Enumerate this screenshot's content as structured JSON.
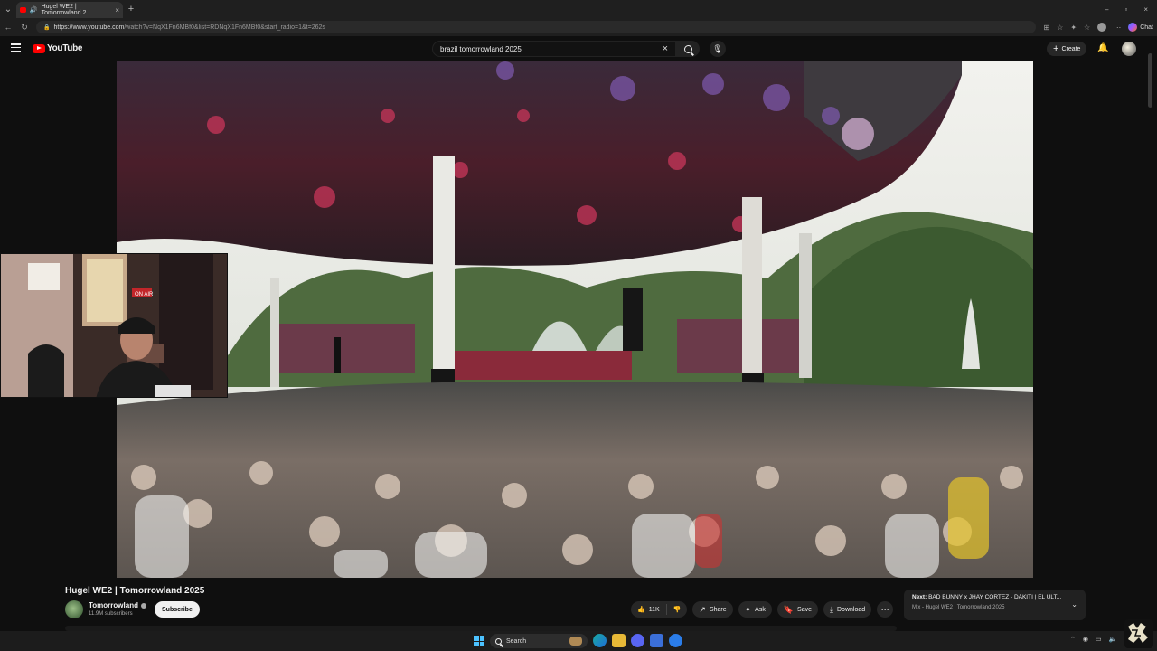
{
  "browser": {
    "tab_title": "Hugel WE2 | Tomorrowland 2",
    "tab_close": "×",
    "new_tab": "+",
    "url_host": "https://www.youtube.com",
    "url_path": "/watch?v=NqX1Fn6MBf0&list=RDNqX1Fn6MBf0&start_radio=1&t=262s",
    "chat_label": "Chat",
    "window_controls": [
      "–",
      "▫",
      "×"
    ]
  },
  "youtube": {
    "logo_text": "YouTube",
    "search_value": "brazil tomorrowland 2025",
    "search_clear": "×",
    "create_label": "Create",
    "create_plus": "+"
  },
  "video": {
    "title": "Hugel WE2 | Tomorrowland 2025",
    "channel": "Tomorrowland",
    "subscribers": "11.9M subscribers",
    "subscribe_label": "Subscribe",
    "likes": "11K",
    "share_label": "Share",
    "ask_label": "Ask",
    "save_label": "Save",
    "download_label": "Download",
    "more_label": "⋯"
  },
  "up_next": {
    "prefix": "Next:",
    "title": "BAD BUNNY x JHAY CORTEZ - DÁKITI | EL ÚLT...",
    "subtitle": "Mix - Hugel WE2 | Tomorrowland 2025"
  },
  "webcam": {
    "sign": "ON AIR"
  },
  "taskbar": {
    "search_label": "Search"
  },
  "colors": {
    "youtube_red": "#ff0000",
    "background": "#0f0f0f",
    "pill": "#272727"
  }
}
